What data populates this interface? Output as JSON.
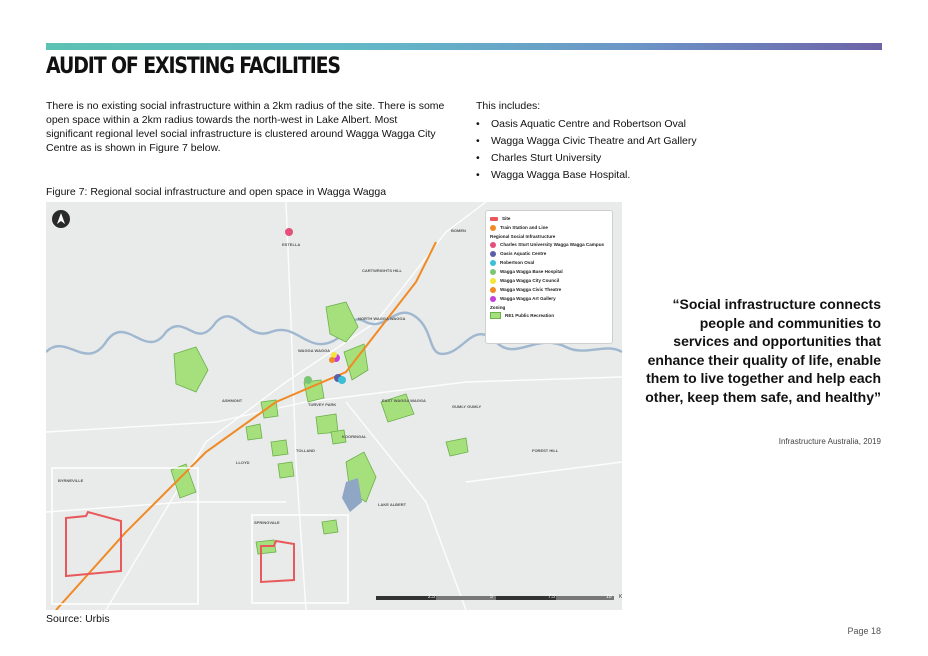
{
  "page": {
    "title": "AUDIT OF EXISTING FACILITIES",
    "intro": "There is no existing social infrastructure within a 2km radius of the site. There is some open space within a 2km radius towards the north-west in Lake Albert. Most significant regional level social infrastructure is clustered around Wagga Wagga City Centre as is shown in Figure 7 below.",
    "includes_heading": "This includes:",
    "includes": [
      "Oasis Aquatic Centre and Robertson Oval",
      "Wagga Wagga Civic Theatre and Art Gallery",
      "Charles Sturt University",
      "Wagga Wagga Base Hospital."
    ],
    "figure_caption": "Figure 7: Regional social infrastructure and open space in Wagga Wagga",
    "source": "Source: Urbis",
    "quote": "“Social infrastructure connects people and communities to services and opportunities that enhance their quality of life, enable them to live together and help each other, keep them safe, and healthy”",
    "quote_attribution": "Infrastructure Australia, 2019",
    "page_number": "Page 18"
  },
  "map": {
    "legend": {
      "site": "Site",
      "train": "Train Station and Line",
      "regional_heading": "Regional Social Infrastructure",
      "items": [
        {
          "label": "Charles Sturt University Wagga Wagga Campus",
          "color": "#e5507a"
        },
        {
          "label": "Oasis Aquatic Centre",
          "color": "#5b5fa8"
        },
        {
          "label": "Robertson Oval",
          "color": "#3bbfd6"
        },
        {
          "label": "Wagga Wagga Base Hospital",
          "color": "#7cc576"
        },
        {
          "label": "Wagga Wagga City Council",
          "color": "#f5e536"
        },
        {
          "label": "Wagga Wagga Civic Theatre",
          "color": "#f08a24"
        },
        {
          "label": "Wagga Wagga Art Gallery",
          "color": "#c63fd9"
        }
      ],
      "zoning_heading": "Zoning",
      "zoning_item": "RE1 Public Recreation"
    },
    "place_labels": [
      "BOMEN",
      "ESTELLA",
      "CARTWRIGHTS HILL",
      "NORTH WAGGA WAGGA",
      "WAGGA WAGGA",
      "EAST WAGGA WAGGA",
      "GUMLY GUMLY",
      "KOORINGAL",
      "TURVEY PARK",
      "LLOYD",
      "TOLLAND",
      "ASHMONT",
      "LAKE ALBERT",
      "SPRINGVALE",
      "FOREST HILL",
      "BYRNEVILLE"
    ],
    "scale": {
      "ticks": [
        "2.5",
        "5",
        "7.5",
        "10"
      ],
      "unit": "KM"
    },
    "colors": {
      "background": "#e9eaea",
      "open_space": "#a6e07c",
      "river": "#9fb7cf",
      "rail": "#f08a24",
      "site": "#e8595c"
    }
  }
}
